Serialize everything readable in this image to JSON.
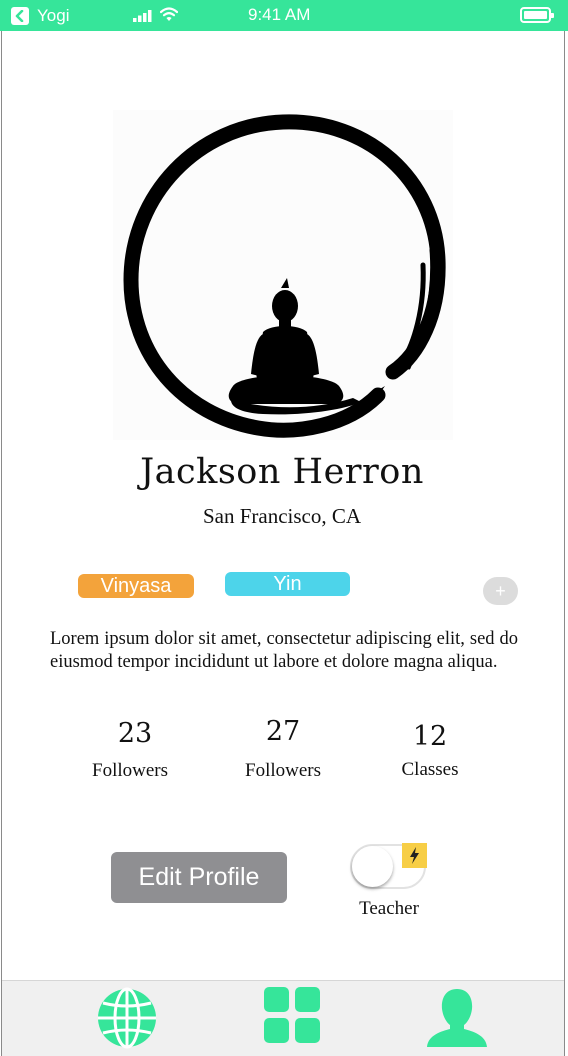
{
  "status_bar": {
    "back_app": "Yogi",
    "time": "9:41 AM",
    "color": "#36e59a"
  },
  "profile": {
    "name": "Jackson Herron",
    "location": "San Francisco, CA",
    "tags": [
      {
        "label": "Vinyasa",
        "color": "#f3a33b"
      },
      {
        "label": "Yin",
        "color": "#4dd4ea"
      }
    ],
    "add_tag": "+",
    "bio": "Lorem ipsum dolor sit amet, consectetur adipiscing elit, sed do eiusmod tempor incididunt ut labore et dolore magna aliqua.",
    "stats": [
      {
        "value": "23",
        "label": "Followers"
      },
      {
        "value": "27",
        "label": "Followers"
      },
      {
        "value": "12",
        "label": "Classes"
      }
    ]
  },
  "actions": {
    "edit_profile": "Edit Profile",
    "teacher_toggle_label": "Teacher",
    "teacher_toggle_on": false
  },
  "tab_bar": {
    "tabs": [
      {
        "icon": "globe-icon"
      },
      {
        "icon": "grid-icon"
      },
      {
        "icon": "profile-icon"
      }
    ],
    "accent": "#36e59a"
  }
}
